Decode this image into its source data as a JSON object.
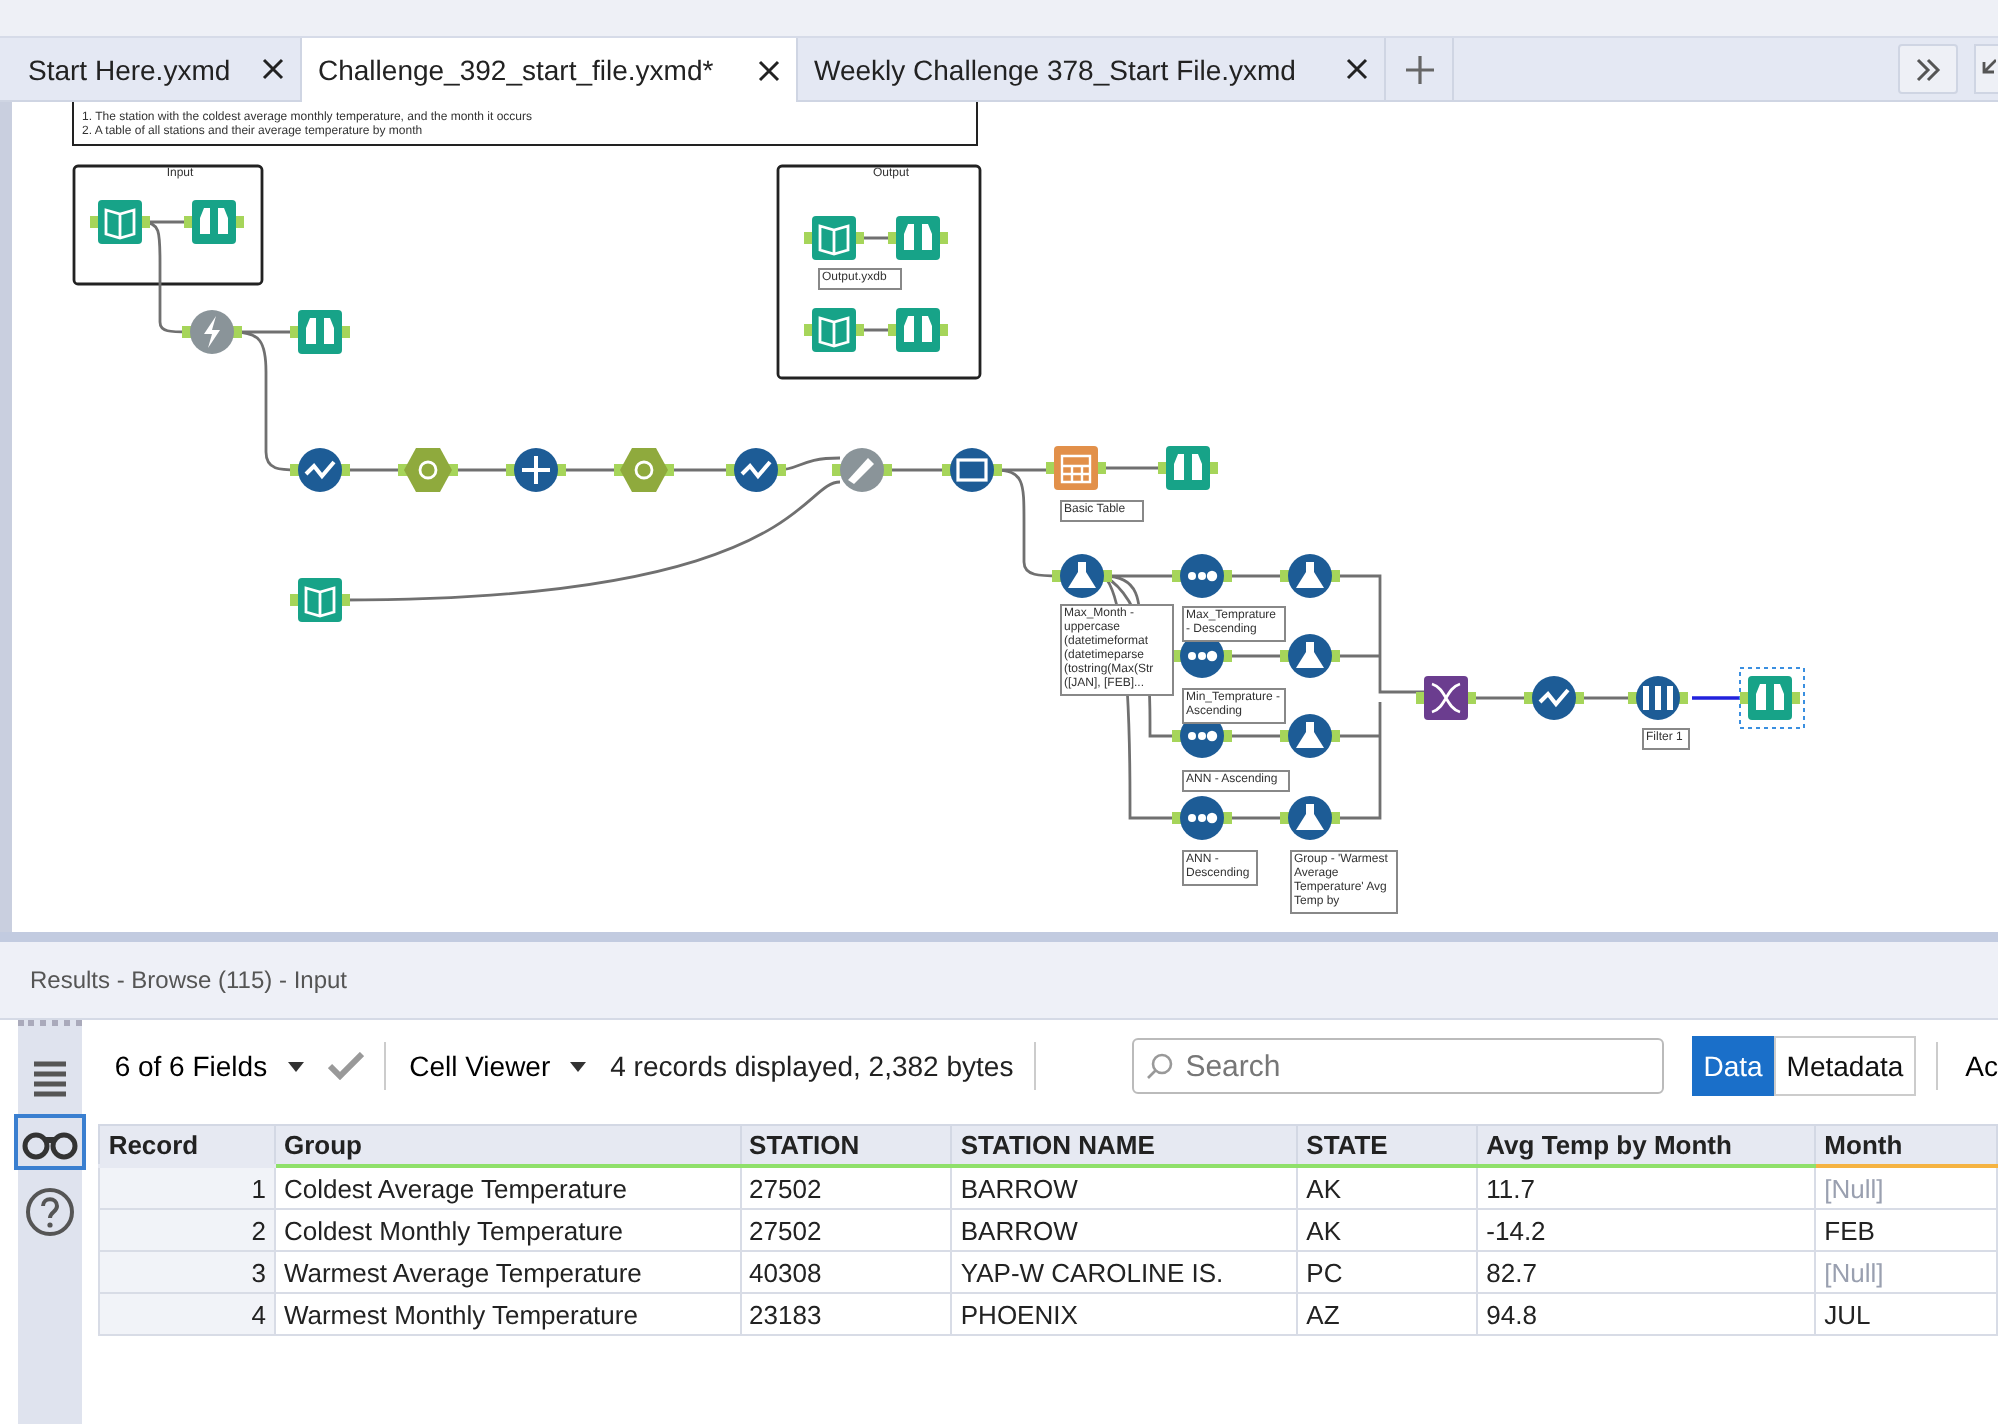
{
  "tabs": [
    {
      "label": "Start Here.yxmd",
      "selected": false
    },
    {
      "label": "Challenge_392_start_file.yxmd*",
      "selected": true
    },
    {
      "label": "Weekly Challenge 378_Start File.yxmd",
      "selected": false
    }
  ],
  "canvas": {
    "comment_lines": [
      "1. The station with the coldest average monthly temperature, and the month it occurs",
      "2. A table of all stations and their average temperature by month"
    ],
    "containers": [
      {
        "title": "Input"
      },
      {
        "title": "Output"
      }
    ],
    "annotations": [
      "Output.yxdb",
      "Basic Table",
      "Max_Month - uppercase (datetimeformat (datetimeparse (tostring(Max(Str ([JAN], [FEB]...",
      "Max_Temprature - Descending",
      "Min_Temprature - Ascending",
      "ANN - Ascending",
      "ANN - Descending",
      "Group - 'Warmest Average Temperature' Avg Temp by",
      "Filter 1"
    ]
  },
  "results": {
    "title": "Results - Browse (115) - Input",
    "fields": "6 of 6 Fields",
    "viewer": "Cell Viewer",
    "summary": "4 records displayed, 2,382 bytes",
    "search": {
      "placeholder": "Search"
    },
    "view_tabs": [
      {
        "label": "Data",
        "selected": true
      },
      {
        "label": "Metadata",
        "selected": false
      }
    ],
    "cut_button": "Ac",
    "columns": [
      {
        "label": "Record",
        "color": "#e6e9f2"
      },
      {
        "label": "Group",
        "color": "#8fe06a"
      },
      {
        "label": "STATION",
        "color": "#8fe06a"
      },
      {
        "label": "STATION NAME",
        "color": "#8fe06a"
      },
      {
        "label": "STATE",
        "color": "#8fe06a"
      },
      {
        "label": "Avg Temp by Month",
        "color": "#8fe06a"
      },
      {
        "label": "Month",
        "color": "#f5b342"
      }
    ],
    "rows": [
      {
        "cells": [
          "1",
          "Coldest Average Temperature",
          "27502",
          "BARROW",
          "AK",
          "11.7"
        ],
        "month": "[Null]",
        "month_null": true
      },
      {
        "cells": [
          "2",
          "Coldest Monthly Temperature",
          "27502",
          "BARROW",
          "AK",
          "-14.2"
        ],
        "month": "FEB",
        "month_null": false
      },
      {
        "cells": [
          "3",
          "Warmest Average Temperature",
          "40308",
          "YAP-W CAROLINE IS.",
          "PC",
          "82.7"
        ],
        "month": "[Null]",
        "month_null": true
      },
      {
        "cells": [
          "4",
          "Warmest Monthly Temperature",
          "23183",
          "PHOENIX",
          "AZ",
          "94.8"
        ],
        "month": "JUL",
        "month_null": false
      }
    ]
  }
}
